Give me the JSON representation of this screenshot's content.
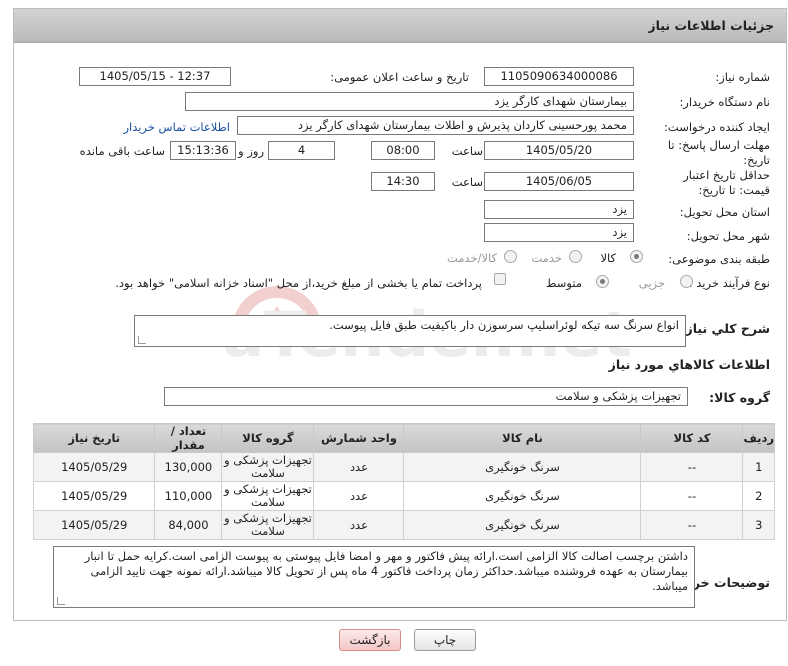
{
  "header": {
    "title": "جزئیات اطلاعات نیاز"
  },
  "labels": {
    "need_number": "شماره نیاز:",
    "announce_datetime": "تاریخ و ساعت اعلان عمومی:",
    "buyer_org": "نام دستگاه خریدار:",
    "requester": "ایجاد کننده درخواست:",
    "contact_link": "اطلاعات تماس خریدار",
    "reply_deadline": "مهلت ارسال پاسخ: تا تاریخ:",
    "time": "ساعت",
    "day_and": "روز و",
    "remaining": "ساعت باقی مانده",
    "price_validity": "حداقل تاریخ اعتبار قیمت: تا تاریخ:",
    "province": "استان محل تحویل:",
    "city": "شهر محل تحویل:",
    "category": "طبقه بندی موضوعی:",
    "process": "نوع فرآیند خرید :",
    "general_desc": "شرح کلي نياز:",
    "goods_info": "اطلاعات کالاهاي مورد نياز",
    "goods_group": "گروه کالا:",
    "buyer_notes": "توضیحات خریدار:"
  },
  "fields": {
    "need_number": "1105090634000086",
    "announce_datetime": "1405/05/15 - 12:37",
    "buyer_org": "بیمارستان شهدای کارگر یزد",
    "requester": "محمد پورحسینی کاردان پذیرش و اطلات بیمارستان شهدای کارگر یزد",
    "reply_date": "1405/05/20",
    "reply_time": "08:00",
    "days": "4",
    "remaining_time": "15:13:36",
    "validity_date": "1405/06/05",
    "validity_time": "14:30",
    "province": "یزد",
    "city": "یزد",
    "general_desc": "انواع سرنگ سه تیکه لوئراسلیپ سرسوزن دار باکیفیت طبق فایل پیوست.",
    "goods_group": "تجهیزات پزشکی و سلامت",
    "buyer_notes": "داشتن برچسب اصالت کالا الزامی است.ارائه پیش فاکتور و مهر و امضا فایل پیوستی به پیوست الزامی است.کرایه حمل تا انبار بیمارستان به عهده فروشنده میباشد.حداکثر زمان پرداخت فاکتور 4 ماه پس از تحویل کالا میباشد.ارائه نمونه جهت تایید الزامی میباشد."
  },
  "category_options": [
    {
      "label": "کالا",
      "selected": true
    },
    {
      "label": "خدمت",
      "selected": false
    },
    {
      "label": "کالا/خدمت",
      "selected": false
    }
  ],
  "process_options": [
    {
      "label": "جزیی",
      "selected": false
    },
    {
      "label": "متوسط",
      "selected": true
    }
  ],
  "payment_note": "پرداخت تمام یا بخشی از مبلغ خرید،از محل \"اسناد خزانه اسلامی\" خواهد بود.",
  "table": {
    "headers": [
      "ردیف",
      "کد کالا",
      "نام کالا",
      "واحد شمارش",
      "گروه کالا",
      "تعداد / مقدار",
      "تاریخ نیاز"
    ],
    "rows": [
      [
        "1",
        "--",
        "سرنگ خونگیری",
        "عدد",
        "تجهیزات پزشکی و سلامت",
        "130,000",
        "1405/05/29"
      ],
      [
        "2",
        "--",
        "سرنگ خونگیری",
        "عدد",
        "تجهیزات پزشکی و سلامت",
        "110,000",
        "1405/05/29"
      ],
      [
        "3",
        "--",
        "سرنگ خونگیری",
        "عدد",
        "تجهیزات پزشکی و سلامت",
        "84,000",
        "1405/05/29"
      ]
    ]
  },
  "buttons": {
    "print": "چاپ",
    "back": "بازگشت"
  },
  "watermark": "AriaTender.net"
}
